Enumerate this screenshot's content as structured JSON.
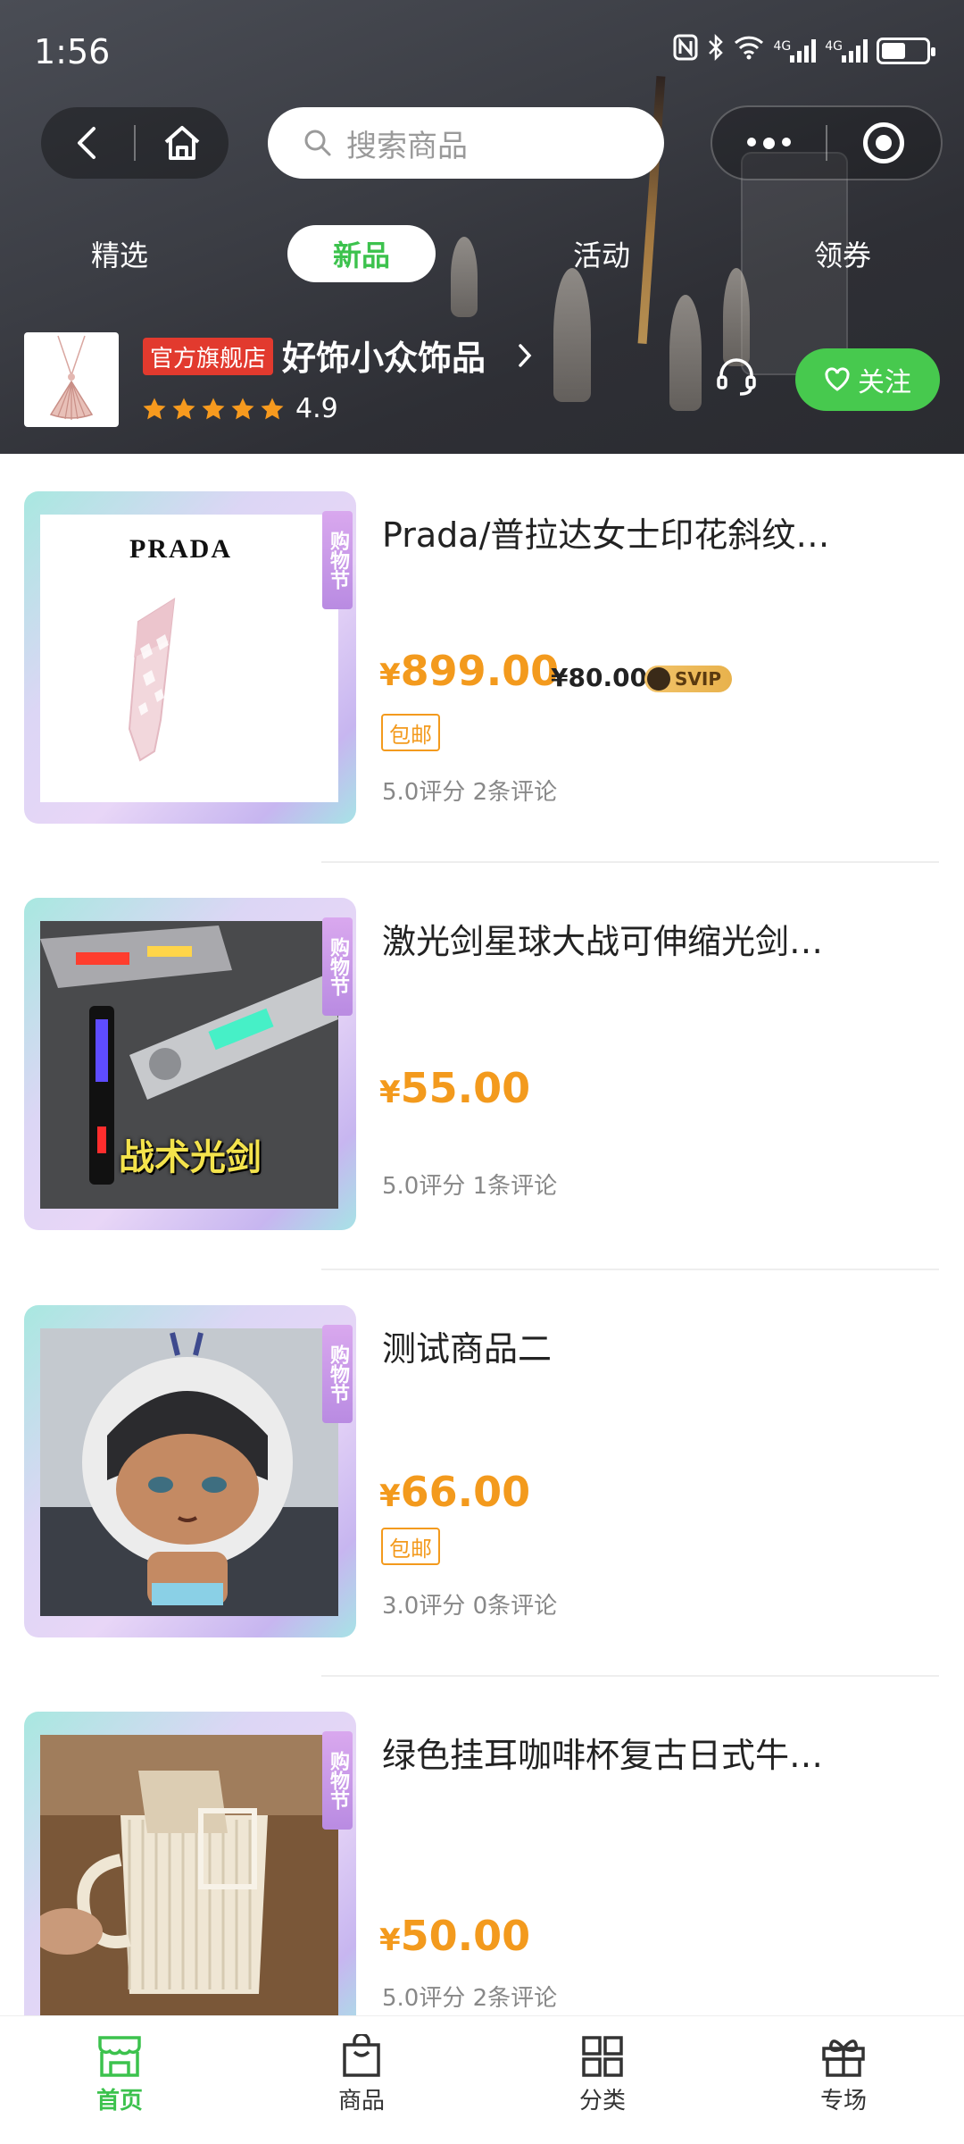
{
  "status_bar": {
    "time": "1:56",
    "net1": "4G",
    "net2": "4G",
    "battery_level": 0.55
  },
  "search": {
    "placeholder": "搜索商品"
  },
  "tabs": [
    {
      "label": "精选",
      "active": false
    },
    {
      "label": "新品",
      "active": true
    },
    {
      "label": "活动",
      "active": false
    },
    {
      "label": "领券",
      "active": false
    }
  ],
  "shop": {
    "badge": "官方旗舰店",
    "name": "好饰小众饰品",
    "rating": "4.9",
    "stars": 5,
    "follow_label": "关注"
  },
  "festival_tag": "购物节",
  "products": [
    {
      "title": "Prada/普拉达女士印花斜纹…",
      "currency": "¥",
      "price": "899.00",
      "vip_price": "¥80.00",
      "vip_badge": "SVIP",
      "free_shipping": "包邮",
      "reviews": "5.0评分 2条评论",
      "image_text": "PRADA"
    },
    {
      "title": "激光剑星球大战可伸缩光剑…",
      "currency": "¥",
      "price": "55.00",
      "reviews": "5.0评分 1条评论",
      "image_text": "战术光剑"
    },
    {
      "title": "测试商品二",
      "currency": "¥",
      "price": "66.00",
      "free_shipping": "包邮",
      "reviews": "3.0评分 0条评论"
    },
    {
      "title": "绿色挂耳咖啡杯复古日式牛…",
      "currency": "¥",
      "price": "50.00",
      "reviews": "5.0评分 2条评论"
    }
  ],
  "tabbar": [
    {
      "label": "首页",
      "icon": "home-store-icon",
      "active": true
    },
    {
      "label": "商品",
      "icon": "bag-icon",
      "active": false
    },
    {
      "label": "分类",
      "icon": "grid-icon",
      "active": false
    },
    {
      "label": "专场",
      "icon": "gift-icon",
      "active": false
    }
  ],
  "colors": {
    "accent_green": "#3cc24d",
    "price_orange": "#f39a1d",
    "badge_red": "#e23a2e"
  }
}
